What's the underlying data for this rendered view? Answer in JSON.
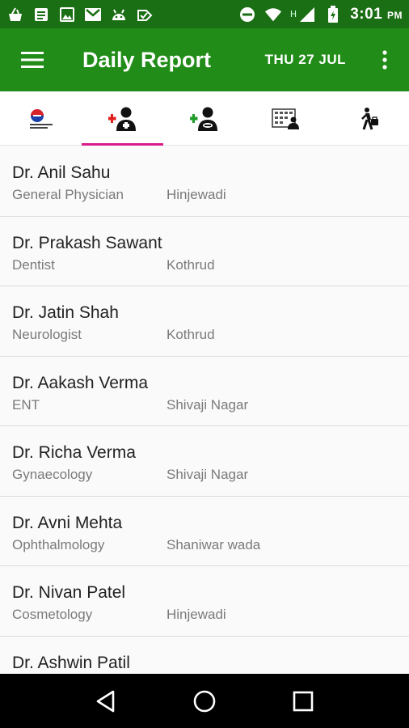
{
  "status_bar": {
    "time": "3:01",
    "ampm": "PM",
    "network": "H",
    "left_icons": [
      "bag-icon",
      "notes-icon",
      "image-icon",
      "gmail-icon",
      "android-icon",
      "check-badge-icon"
    ],
    "right_icons": [
      "do-not-disturb-icon",
      "wifi-icon",
      "signal-icon",
      "battery-charging-icon"
    ]
  },
  "app_bar": {
    "title": "Daily Report",
    "date": "THU 27 JUL",
    "background": "#218c18",
    "status_background": "#1a6e13"
  },
  "tabs": [
    {
      "icon": "report-icon",
      "active": false
    },
    {
      "icon": "add-doctor-icon",
      "active": true
    },
    {
      "icon": "add-chemist-icon",
      "active": false
    },
    {
      "icon": "schedule-icon",
      "active": false
    },
    {
      "icon": "walking-person-icon",
      "active": false
    }
  ],
  "tab_indicator_color": "#d9198a",
  "doctors": [
    {
      "name": "Dr. Anil Sahu",
      "speciality": "General Physician",
      "location": "Hinjewadi"
    },
    {
      "name": "Dr. Prakash Sawant",
      "speciality": "Dentist",
      "location": "Kothrud"
    },
    {
      "name": "Dr. Jatin Shah",
      "speciality": "Neurologist",
      "location": "Kothrud"
    },
    {
      "name": "Dr. Aakash Verma",
      "speciality": "ENT",
      "location": "Shivaji Nagar"
    },
    {
      "name": "Dr. Richa Verma",
      "speciality": "Gynaecology",
      "location": "Shivaji Nagar"
    },
    {
      "name": "Dr. Avni Mehta",
      "speciality": "Ophthalmology",
      "location": "Shaniwar wada"
    },
    {
      "name": "Dr. Nivan Patel",
      "speciality": "Cosmetology",
      "location": "Hinjewadi"
    },
    {
      "name": "Dr. Ashwin Patil",
      "speciality": "",
      "location": ""
    }
  ],
  "nav_bar": [
    "back-icon",
    "home-icon",
    "recents-icon"
  ]
}
